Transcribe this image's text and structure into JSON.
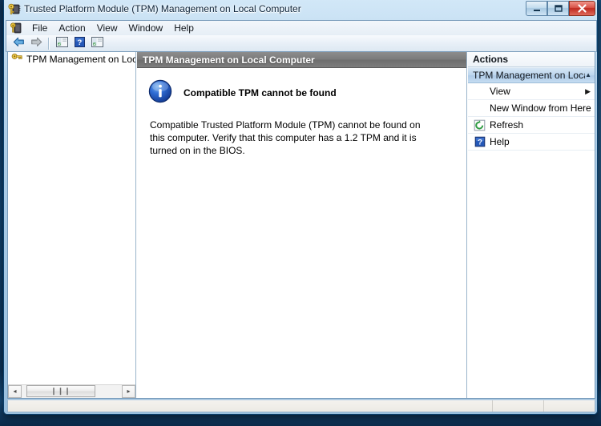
{
  "window": {
    "title": "Trusted Platform Module (TPM) Management on Local Computer",
    "app_icon": "tpm-key-chip-icon",
    "controls": {
      "minimize_label": "—",
      "maximize_label": "□",
      "close_label": "✕",
      "minimize_name": "minimize-button",
      "maximize_name": "maximize-button",
      "close_name": "close-button"
    },
    "colors": {
      "close_button": "#bf2a20",
      "frame": "#0a3f6b",
      "result_header": "#7b7b7b",
      "actions_group_header": "#bcd6ee",
      "info_icon": "#1a56b8",
      "desktop": "#10426e"
    }
  },
  "menubar": {
    "icon": "mmc-console-icon",
    "items": [
      {
        "label": "File"
      },
      {
        "label": "Action"
      },
      {
        "label": "View"
      },
      {
        "label": "Window"
      },
      {
        "label": "Help"
      }
    ]
  },
  "toolbar": {
    "buttons": [
      {
        "name": "back-button",
        "icon": "back-arrow-icon",
        "enabled": true
      },
      {
        "name": "forward-button",
        "icon": "forward-arrow-icon",
        "enabled": false
      },
      {
        "name": "show-hide-console-tree-button",
        "icon": "console-tree-icon",
        "enabled": true
      },
      {
        "name": "help-button",
        "icon": "question-mark-icon",
        "enabled": true
      },
      {
        "name": "show-hide-action-pane-button",
        "icon": "action-pane-icon",
        "enabled": true
      }
    ]
  },
  "tree": {
    "items": [
      {
        "label": "TPM Management on Local",
        "icon": "tpm-key-icon",
        "selected": false
      }
    ],
    "scrollbar": {
      "left_arrow": "◂",
      "right_arrow": "▸",
      "thumb_grip": "❙❙❙"
    }
  },
  "result": {
    "header_title": "TPM Management on Local Computer",
    "info_icon": "info-circle-icon",
    "heading": "Compatible TPM cannot be found",
    "paragraph": "Compatible Trusted Platform Module (TPM) cannot be found on this computer. Verify that this computer has a 1.2 TPM and it is turned on in the BIOS."
  },
  "actions": {
    "header_title": "Actions",
    "group": {
      "label": "TPM Management on Local …",
      "collapse_glyph": "▲"
    },
    "items": [
      {
        "label": "View",
        "icon": null,
        "submenu_arrow": "▶"
      },
      {
        "label": "New Window from Here",
        "icon": null,
        "submenu_arrow": ""
      },
      {
        "label": "Refresh",
        "icon": "refresh-icon",
        "submenu_arrow": ""
      },
      {
        "label": "Help",
        "icon": "help-icon",
        "submenu_arrow": ""
      }
    ]
  },
  "statusbar": {
    "main_text": "",
    "segment1_text": "",
    "segment2_text": ""
  }
}
